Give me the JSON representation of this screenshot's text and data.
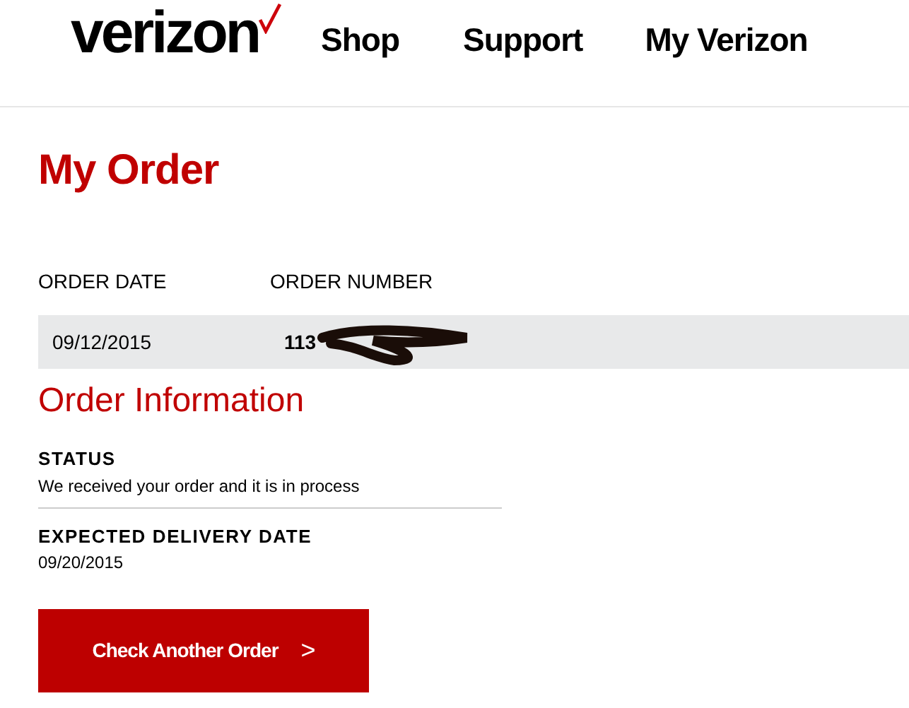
{
  "header": {
    "logo": "verizon",
    "nav": [
      "Shop",
      "Support",
      "My Verizon"
    ]
  },
  "page_title": "My Order",
  "order_table": {
    "columns": [
      "ORDER DATE",
      "ORDER NUMBER"
    ],
    "row": {
      "order_date": "09/12/2015",
      "order_number": "113"
    }
  },
  "order_information": {
    "title": "Order Information",
    "fields": [
      {
        "label": "STATUS",
        "value": "We received your order and it is in process"
      },
      {
        "label": "EXPECTED DELIVERY DATE",
        "value": "09/20/2015"
      }
    ]
  },
  "button": {
    "label": "Check Another Order",
    "arrow": ">"
  }
}
